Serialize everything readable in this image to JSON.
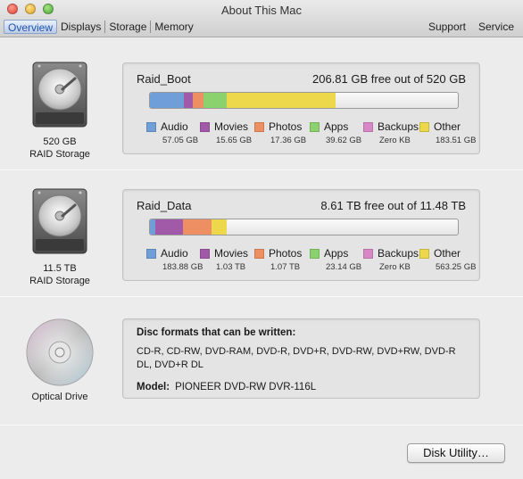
{
  "window": {
    "title": "About This Mac"
  },
  "tabs": [
    {
      "label": "Overview",
      "active": true
    },
    {
      "label": "Displays"
    },
    {
      "label": "Storage"
    },
    {
      "label": "Memory"
    }
  ],
  "right_tabs": [
    "Support",
    "Service"
  ],
  "drives": [
    {
      "icon": "hard-drive-icon",
      "caption_line1": "520 GB",
      "caption_line2": "RAID Storage",
      "volume_name": "Raid_Boot",
      "free_text": "206.81 GB free out of 520 GB",
      "segments_fraction": {
        "audio": 0.11,
        "movies": 0.03,
        "photos": 0.033,
        "apps": 0.076,
        "other": 0.353
      },
      "legend": [
        {
          "label": "Audio",
          "value": "57.05 GB"
        },
        {
          "label": "Movies",
          "value": "15.65 GB"
        },
        {
          "label": "Photos",
          "value": "17.36 GB"
        },
        {
          "label": "Apps",
          "value": "39.62 GB"
        },
        {
          "label": "Backups",
          "value": "Zero KB"
        },
        {
          "label": "Other",
          "value": "183.51 GB"
        }
      ]
    },
    {
      "icon": "hard-drive-icon",
      "caption_line1": "11.5 TB",
      "caption_line2": "RAID Storage",
      "volume_name": "Raid_Data",
      "free_text": "8.61 TB free out of 11.48 TB",
      "segments_fraction": {
        "audio": 0.016,
        "movies": 0.09,
        "photos": 0.093,
        "apps": 0.002,
        "other": 0.049
      },
      "legend": [
        {
          "label": "Audio",
          "value": "183.88 GB"
        },
        {
          "label": "Movies",
          "value": "1.03 TB"
        },
        {
          "label": "Photos",
          "value": "1.07 TB"
        },
        {
          "label": "Apps",
          "value": "23.14 GB"
        },
        {
          "label": "Backups",
          "value": "Zero KB"
        },
        {
          "label": "Other",
          "value": "563.25 GB"
        }
      ]
    }
  ],
  "optical": {
    "icon": "optical-disc-icon",
    "caption": "Optical Drive",
    "formats_heading": "Disc formats that can be written:",
    "formats": "CD-R, CD-RW, DVD-RAM, DVD-R, DVD+R, DVD-RW, DVD+RW, DVD-R DL, DVD+R DL",
    "model_label": "Model:",
    "model_value": "PIONEER DVD-RW DVR-116L"
  },
  "colors": {
    "audio": "#6f9ed8",
    "movies": "#a05aa8",
    "photos": "#ee8f63",
    "apps": "#8bd16d",
    "backups": "#d787c6",
    "other": "#ecd84a"
  },
  "button": {
    "label": "Disk Utility…"
  }
}
